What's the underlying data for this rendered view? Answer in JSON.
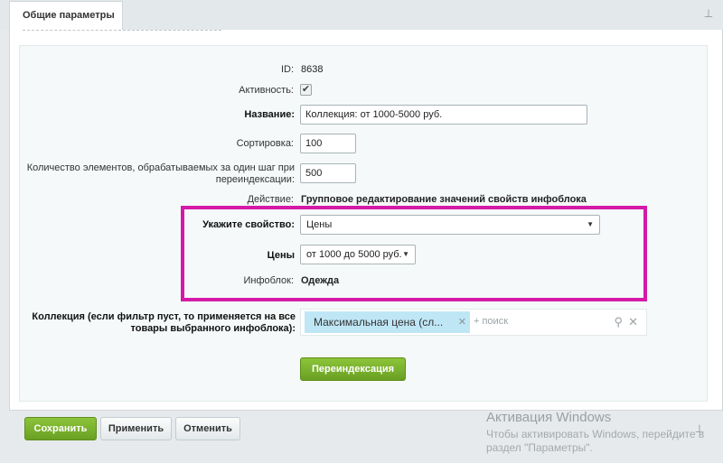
{
  "tab": {
    "title": "Общие параметры"
  },
  "form": {
    "id_label": "ID:",
    "id_value": "8638",
    "active_label": "Активность:",
    "active_checked": true,
    "name_label": "Название:",
    "name_value": "Коллекция: от 1000-5000 руб.",
    "sort_label": "Сортировка:",
    "sort_value": "100",
    "batch_label_line1": "Количество элементов, обрабатываемых за один шаг при",
    "batch_label_line2": "переиндексации:",
    "batch_value": "500",
    "action_label": "Действие:",
    "action_value": "Групповое редактирование значений свойств инфоблока",
    "property_label": "Укажите свойство:",
    "property_value": "Цены",
    "prices_label": "Цены",
    "prices_value": "от 1000 до 5000 руб.",
    "iblock_label": "Инфоблок:",
    "iblock_value": "Одежда",
    "collection_label_line1": "Коллекция (если фильтр пуст, то применяется на все",
    "collection_label_line2": "товары выбранного инфоблока):",
    "collection_tag": "Максимальная цена (сл...",
    "collection_add_placeholder": "+ поиск",
    "reindex_button": "Переиндексация"
  },
  "footer": {
    "save_button": "Сохранить",
    "apply_button": "Применить",
    "cancel_button": "Отменить"
  },
  "watermark": {
    "title": "Активация Windows",
    "line1": "Чтобы активировать Windows, перейдите в",
    "line2": "раздел \"Параметры\"."
  },
  "colors": {
    "highlight_border": "#d51aa8",
    "primary_button": "#7ab32e",
    "tag_background": "#bfe6f5"
  },
  "icons": {
    "pin": "pin-icon",
    "dropdown": "chevron-down-icon",
    "search": "search-icon",
    "clear": "close-icon",
    "tag_remove": "close-icon",
    "checkbox": "checkmark-icon"
  }
}
